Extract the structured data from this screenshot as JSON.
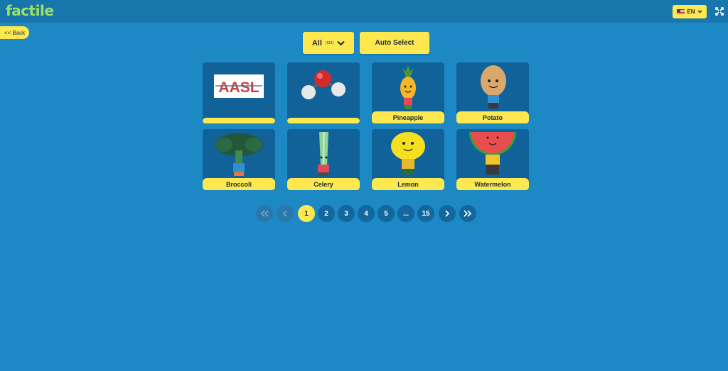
{
  "app": {
    "logo": "factile"
  },
  "header": {
    "language": "EN",
    "language_flag_icon": "us-flag-icon",
    "fullscreen_icon": "expand-icon"
  },
  "nav": {
    "back_label": "<< Back"
  },
  "filter": {
    "selected": "All",
    "count": "(116)",
    "auto_select_label": "Auto Select"
  },
  "cards": [
    {
      "label": "",
      "image": "aasl-logo"
    },
    {
      "label": "",
      "image": "water-molecule"
    },
    {
      "label": "Pineapple",
      "image": "pineapple-character"
    },
    {
      "label": "Potato",
      "image": "potato-character"
    },
    {
      "label": "Broccoli",
      "image": "broccoli-character"
    },
    {
      "label": "Celery",
      "image": "celery-character"
    },
    {
      "label": "Lemon",
      "image": "lemon-character"
    },
    {
      "label": "Watermelon",
      "image": "watermelon-character"
    }
  ],
  "aasl_logo_text": "AASL",
  "pagination": {
    "pages": [
      "1",
      "2",
      "3",
      "4",
      "5",
      "...",
      "15"
    ],
    "current": "1",
    "first_icon": "double-chevron-left-icon",
    "prev_icon": "chevron-left-icon",
    "next_icon": "chevron-right-icon",
    "last_icon": "double-chevron-right-icon"
  }
}
